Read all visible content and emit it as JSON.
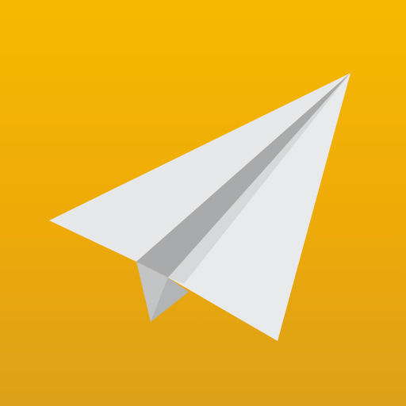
{
  "icon": {
    "name": "paper-plane-icon",
    "colors": {
      "background_top": "#f6b900",
      "background_bottom": "#dca01a",
      "wing_main": "#e7e8e9",
      "wing_shade": "#d3d4d6",
      "fold_shadow": "#a9aaac",
      "fold_mid": "#c7c8ca",
      "keel": "#b7b8ba"
    }
  }
}
